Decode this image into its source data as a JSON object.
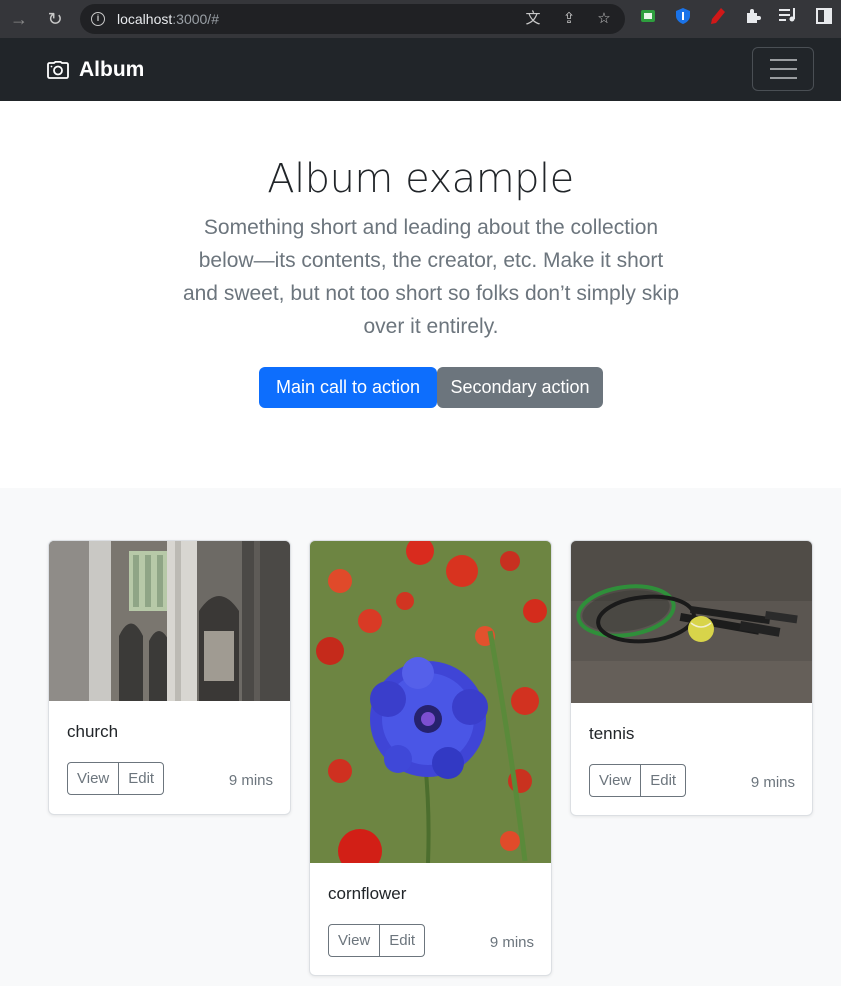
{
  "browser": {
    "url_host": "localhost",
    "url_rest": ":3000/#"
  },
  "navbar": {
    "brand": "Album"
  },
  "hero": {
    "title": "Album example",
    "lead": "Something short and leading about the collection below—its contents, the creator, etc. Make it short and sweet, but not too short so folks don’t simply skip over it entirely.",
    "primary_button": "Main call to action",
    "secondary_button": "Secondary action"
  },
  "cards": [
    {
      "title": "church",
      "view": "View",
      "edit": "Edit",
      "time": "9 mins"
    },
    {
      "title": "cornflower",
      "view": "View",
      "edit": "Edit",
      "time": "9 mins"
    },
    {
      "title": "tennis",
      "view": "View",
      "edit": "Edit",
      "time": "9 mins"
    }
  ],
  "colors": {
    "primary": "#0d6efd",
    "secondary": "#6c757d",
    "navbar": "#212529",
    "album_bg": "#f8f9fa"
  }
}
